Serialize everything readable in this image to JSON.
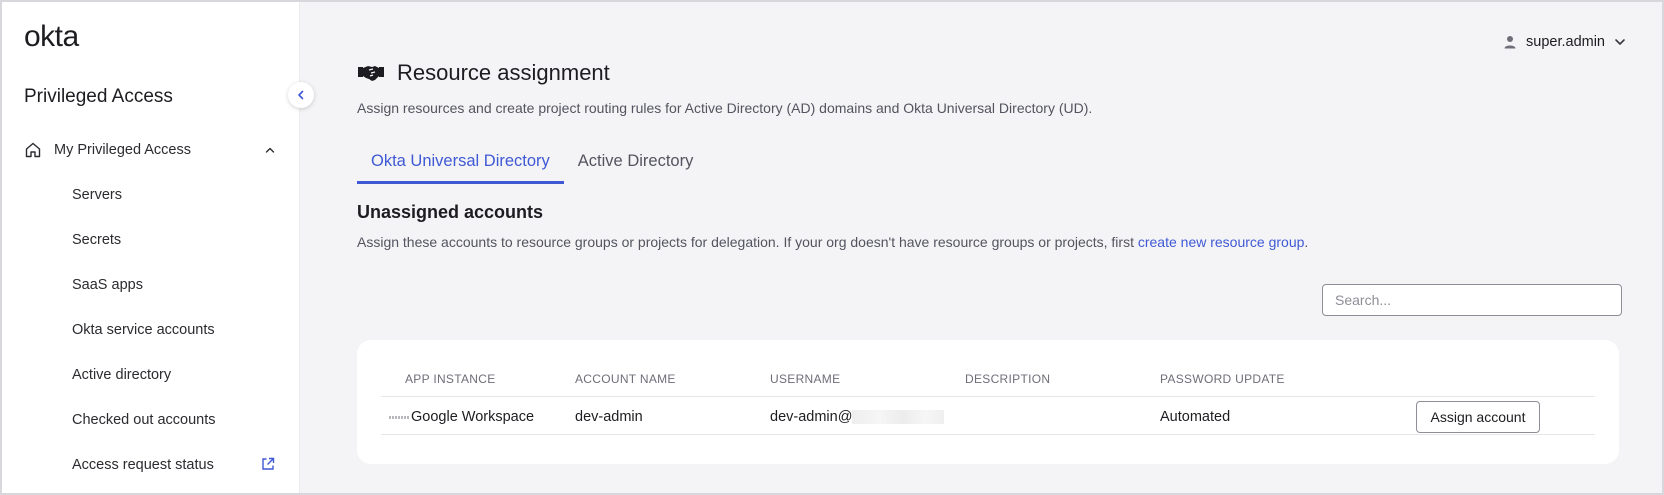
{
  "sidebar": {
    "logo": "okta",
    "product_title": "Privileged Access",
    "group_label": "My Privileged Access",
    "items": [
      {
        "label": "Servers"
      },
      {
        "label": "Secrets"
      },
      {
        "label": "SaaS apps"
      },
      {
        "label": "Okta service accounts"
      },
      {
        "label": "Active directory"
      },
      {
        "label": "Checked out accounts"
      },
      {
        "label": "Access request status"
      }
    ]
  },
  "header": {
    "user": "super.admin",
    "title": "Resource assignment",
    "subtitle": "Assign resources and create project routing rules for Active Directory (AD) domains and Okta Universal Directory (UD)."
  },
  "tabs": [
    {
      "label": "Okta Universal Directory",
      "active": true
    },
    {
      "label": "Active Directory",
      "active": false
    }
  ],
  "section": {
    "title": "Unassigned accounts",
    "description": "Assign these accounts to resource groups or projects for delegation. If your org doesn't have resource groups or projects, first ",
    "link": "create new resource group",
    "link_suffix": "."
  },
  "search": {
    "placeholder": "Search..."
  },
  "table": {
    "columns": [
      "APP INSTANCE",
      "ACCOUNT NAME",
      "USERNAME",
      "DESCRIPTION",
      "PASSWORD UPDATE"
    ],
    "rows": [
      {
        "app_instance": "Google Workspace",
        "account_name": "dev-admin",
        "username": "dev-admin@",
        "description": "",
        "password_update": "Automated",
        "action": "Assign account"
      }
    ]
  },
  "colors": {
    "accent": "#3f59d4",
    "background": "#f4f4f6"
  },
  "icons": [
    "home-icon",
    "chevron-up-icon",
    "chevron-left-icon",
    "external-link-icon",
    "user-icon",
    "chevron-down-icon",
    "handshake-icon"
  ]
}
